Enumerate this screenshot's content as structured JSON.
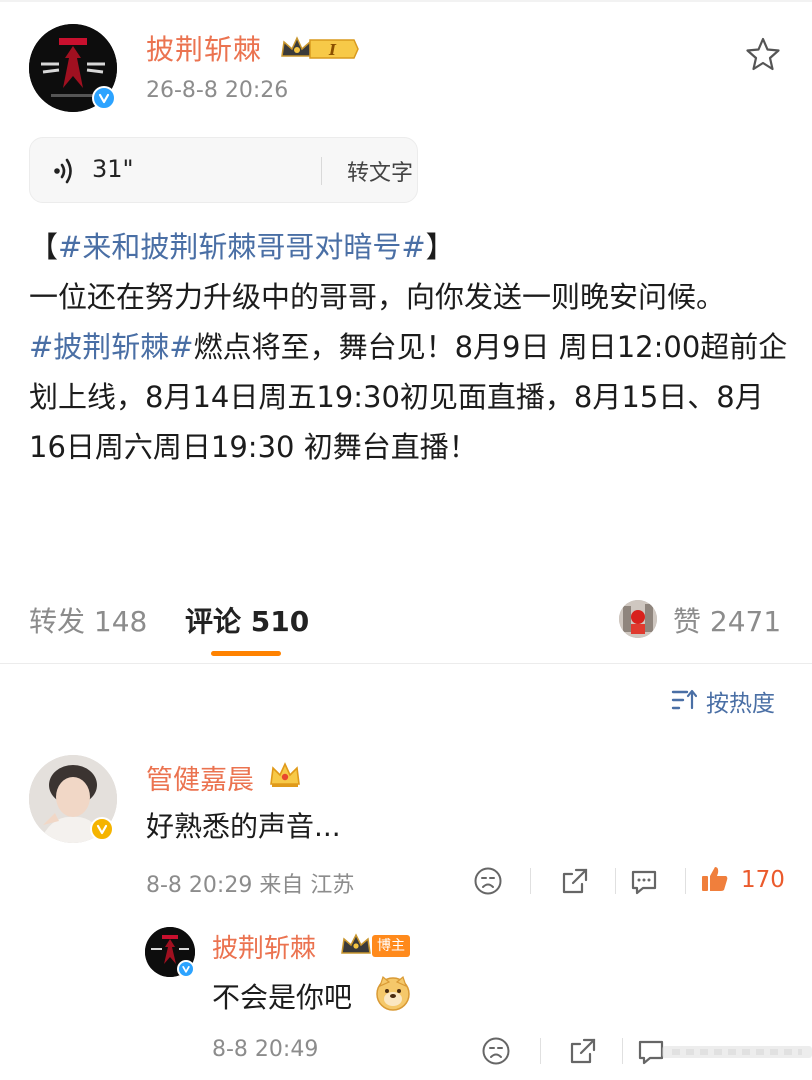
{
  "post": {
    "author": "披荆斩棘",
    "level_badge": "I",
    "time": "26-8-8 20:26",
    "voice": {
      "duration": "31\"",
      "to_text_label": "转文字"
    },
    "body": {
      "line1_open": "【",
      "line1_tag": "#来和披荆斩棘哥哥对暗号#",
      "line1_close": "】",
      "para1": "一位还在努力升级中的哥哥，向你发送一则晚安问候。",
      "tag2": "#披荆斩棘#",
      "para2": "燃点将至，舞台见！8月9日 周日12:00超前企划上线，8月14日周五19:30初见面直播，8月15日、8月16日周六周日19:30 初舞台直播！"
    }
  },
  "action_bar": {
    "repost_label": "转发",
    "repost_count": "148",
    "comment_label": "评论",
    "comment_count": "510",
    "like_label": "赞",
    "like_count": "2471",
    "active_tab_color": "#ff8200"
  },
  "sort": {
    "label": "按热度"
  },
  "comment": {
    "author": "管健嘉晨",
    "text": "好熟悉的声音...",
    "time": "8-8 20:29",
    "location": "来自 江苏",
    "like_count": "170"
  },
  "reply": {
    "author": "披荆斩棘",
    "tag": "博主",
    "text": "不会是你吧",
    "time": "8-8 20:49"
  },
  "colors": {
    "name": "#eb7350",
    "link": "#4a6fa5",
    "verified_blue": "#2ca3ff",
    "verified_gold": "#f5b400"
  },
  "icons": [
    "star-icon",
    "voice-icon",
    "sort-icon",
    "dislike-icon",
    "share-icon",
    "comment-icon",
    "like-icon",
    "crown-icon",
    "doge-emoji"
  ]
}
